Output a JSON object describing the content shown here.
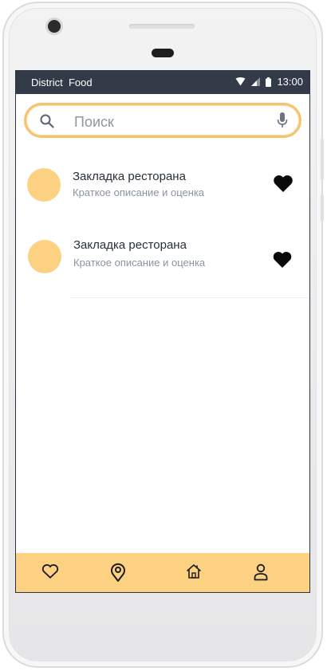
{
  "status_bar": {
    "app_name": "District  Food",
    "time": "13:00",
    "icons": [
      "wifi-icon",
      "signal-icon",
      "battery-icon"
    ]
  },
  "search": {
    "placeholder": "Поиск",
    "value": "",
    "icons": [
      "search-icon",
      "microphone-icon"
    ]
  },
  "bookmarks": [
    {
      "title": "Закладка ресторана",
      "subtitle": "Краткое описание и оценка",
      "favorite": true
    },
    {
      "title": "Закладка ресторана",
      "subtitle": "Краткое описание и оценка",
      "favorite": true
    }
  ],
  "bottom_nav": [
    "heart-icon",
    "location-pin-icon",
    "home-icon",
    "profile-icon"
  ],
  "colors": {
    "accent": "#fdd182",
    "search_border": "#f4c36f",
    "status_bar": "#323b47",
    "title_text": "#27303b",
    "subtitle_text": "#8a93a3"
  }
}
